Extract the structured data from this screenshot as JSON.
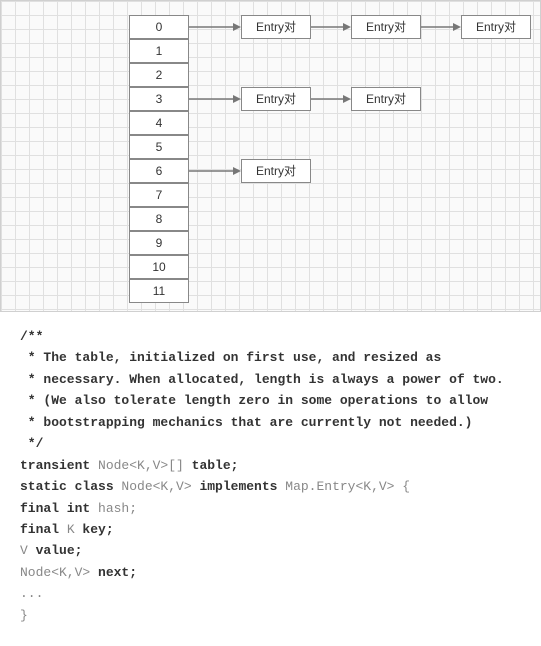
{
  "buckets": [
    "0",
    "1",
    "2",
    "3",
    "4",
    "5",
    "6",
    "7",
    "8",
    "9",
    "10",
    "11"
  ],
  "entryLabel": "Entry对",
  "entry_chains": [
    {
      "bucket_index": 0,
      "length": 3
    },
    {
      "bucket_index": 3,
      "length": 2
    },
    {
      "bucket_index": 6,
      "length": 1
    }
  ],
  "code": {
    "c1": "/**",
    "c2": " * The table, initialized on first use, and resized as",
    "c3": " * necessary. When allocated, length is always a power of two.",
    "c4": " * (We also tolerate length zero in some operations to allow",
    "c5": " * bootstrapping mechanics that are currently not needed.)",
    "c6": " */",
    "kw_transient": "transient",
    "ty_node_arr": " Node<K,V>[] ",
    "fld_table": "table;",
    "kw_static_class": "static class",
    "ty_node": " Node<K,V> ",
    "kw_implements": "implements",
    "ty_mapentry": " Map.Entry<K,V> {",
    "kw_final_int": "final int",
    "fld_hash": " hash;",
    "kw_final": "final",
    "ty_k": " K ",
    "fld_key": "key;",
    "ty_v": "V ",
    "fld_value": "value;",
    "ty_node2": "Node<K,V> ",
    "fld_next": "next;",
    "ellipsis": "...",
    "closing": "}"
  }
}
